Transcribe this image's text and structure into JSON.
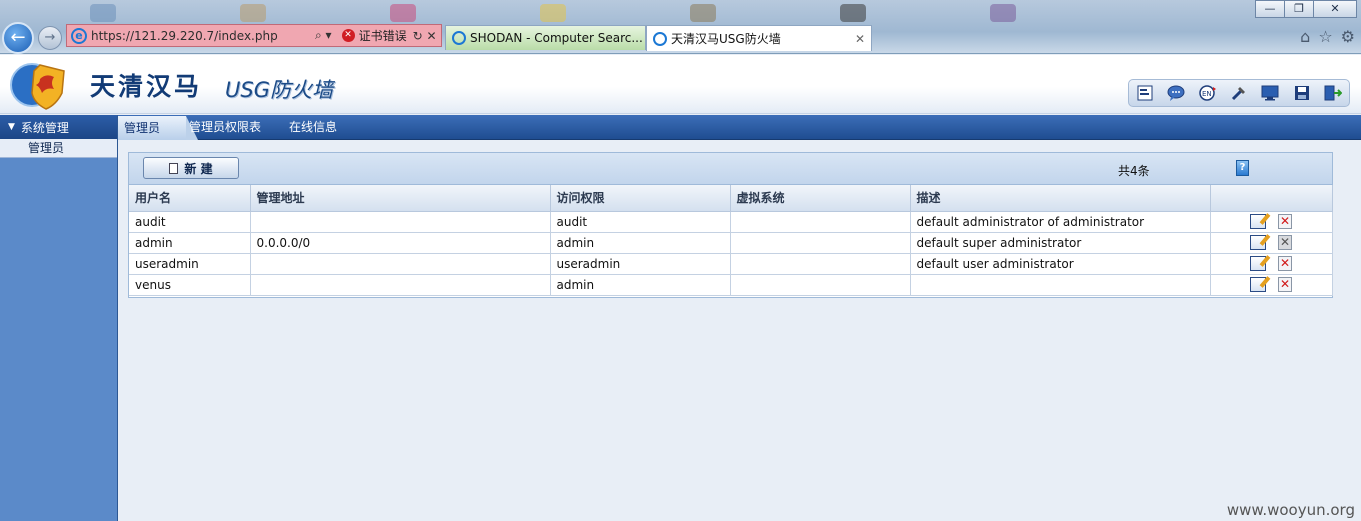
{
  "browser": {
    "window_buttons": [
      "—",
      "❐",
      "✕"
    ],
    "address": "https://121.29.220.7/index.php",
    "address_tools": "⌕ ▾",
    "cert_error": "证书错误",
    "tabs": [
      {
        "title": "SHODAN - Computer Searc...",
        "active": false
      },
      {
        "title": "天清汉马USG防火墙",
        "active": true
      }
    ],
    "tab_close": "✕",
    "home_icon": "home-icon",
    "favorites_icon": "star-icon",
    "settings_icon": "gear-icon"
  },
  "app": {
    "brand_cn": "天清汉马",
    "brand_product": "USG防火墙",
    "toolbar_icons": [
      "notes-icon",
      "chat-icon",
      "language-icon",
      "tools-icon",
      "monitor-icon",
      "save-icon",
      "logout-icon"
    ]
  },
  "sidebar": {
    "section": "系统管理",
    "items": [
      {
        "label": "管理员",
        "active": true
      }
    ]
  },
  "tabs": {
    "items": [
      {
        "label": "管理员",
        "active": true
      },
      {
        "label": "管理员权限表",
        "active": false
      },
      {
        "label": "在线信息",
        "active": false
      }
    ]
  },
  "panel": {
    "new_button": "新 建",
    "count": "共4条",
    "help_icon": "help-icon",
    "columns": [
      "用户名",
      "管理地址",
      "访问权限",
      "虚拟系统",
      "描述",
      ""
    ],
    "rows": [
      {
        "username": "audit",
        "address": "",
        "permission": "audit",
        "vsys": "",
        "description": "default administrator of administrator",
        "delete_enabled": true
      },
      {
        "username": "admin",
        "address": "0.0.0.0/0",
        "permission": "admin",
        "vsys": "",
        "description": "default super administrator",
        "delete_enabled": false
      },
      {
        "username": "useradmin",
        "address": "",
        "permission": "useradmin",
        "vsys": "",
        "description": "default user administrator",
        "delete_enabled": true
      },
      {
        "username": "venus",
        "address": "",
        "permission": "admin",
        "vsys": "",
        "description": "",
        "delete_enabled": true
      }
    ]
  },
  "watermark": "www.wooyun.org",
  "colors": {
    "nav_blue": "#1f4d91",
    "sidebar_blue": "#5b8ac9",
    "address_error": "#f0a7b1",
    "delete_red": "#d11a1a"
  }
}
